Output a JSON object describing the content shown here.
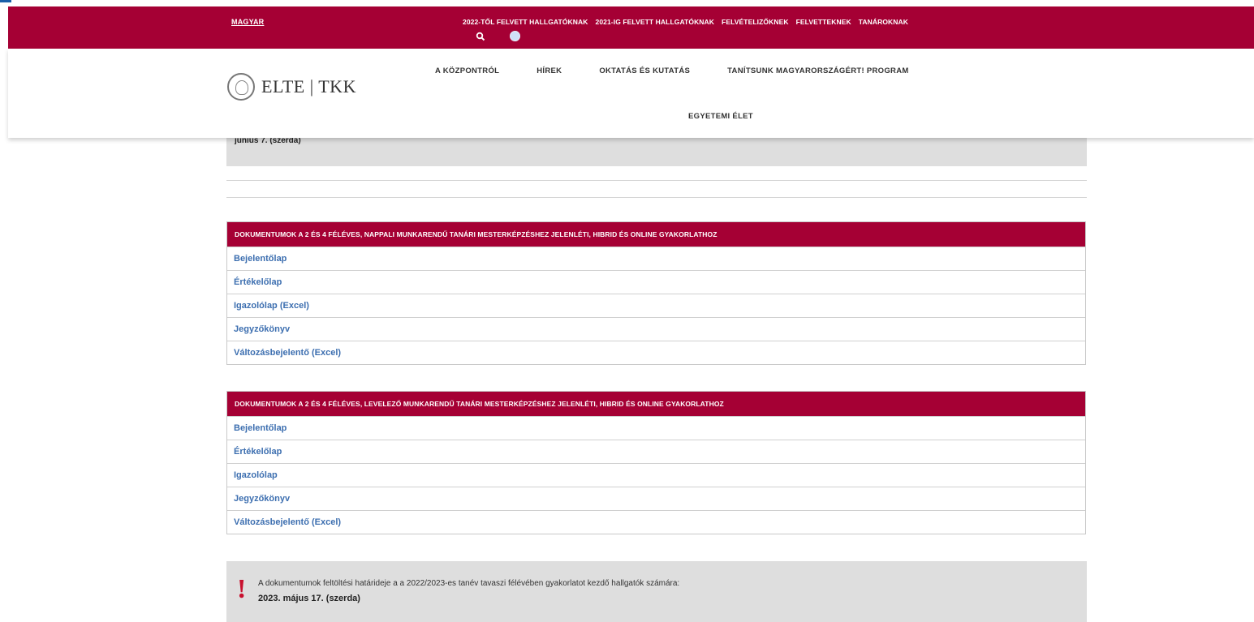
{
  "lang": "MAGYAR",
  "top_links": [
    "2022-TŐL FELVETT HALLGATÓKNAK",
    "2021-IG FELVETT HALLGATÓKNAK",
    "FELVÉTELIZŐKNEK",
    "FELVETTEKNEK",
    "TANÁROKNAK"
  ],
  "logo_text": "ELTE | TKK",
  "nav": [
    "A KÖZPONTRÓL",
    "HÍREK",
    "OKTATÁS ÉS KUTATÁS",
    "TANÍTSUNK MAGYARORSZÁGÉRT! PROGRAM"
  ],
  "nav_second_row": "EGYETEMI ÉLET",
  "note_top": "június 7. (szerda)",
  "table1": {
    "title": "DOKUMENTUMOK A 2 ÉS 4 FÉLÉVES, NAPPALI MUNKARENDŰ TANÁRI MESTERKÉPZÉSHEZ JELENLÉTI, HIBRID ÉS ONLINE GYAKORLATHOZ",
    "rows": [
      "Bejelentőlap",
      "Értékelőlap",
      "Igazolólap (Excel)",
      "Jegyzőkönyv",
      "Változásbejelentő (Excel)"
    ]
  },
  "table2": {
    "title": "DOKUMENTUMOK A 2 ÉS 4 FÉLÉVES, LEVELEZŐ MUNKARENDŰ TANÁRI MESTERKÉPZÉSHEZ JELENLÉTI, HIBRID ÉS ONLINE GYAKORLATHOZ",
    "rows": [
      "Bejelentőlap",
      "Értékelőlap",
      "Igazolólap",
      "Jegyzőkönyv",
      "Változásbejelentő (Excel)"
    ]
  },
  "note_bottom": {
    "line1": "A dokumentumok feltöltési határideje a a 2022/2023-es tanév tavaszi félévében gyakorlatot kezdő hallgatók számára:",
    "line2": "2023. május 17. (szerda)"
  },
  "colors": {
    "brand": "#a50034",
    "link": "#3d6fb0",
    "note_bg": "#dedede"
  }
}
